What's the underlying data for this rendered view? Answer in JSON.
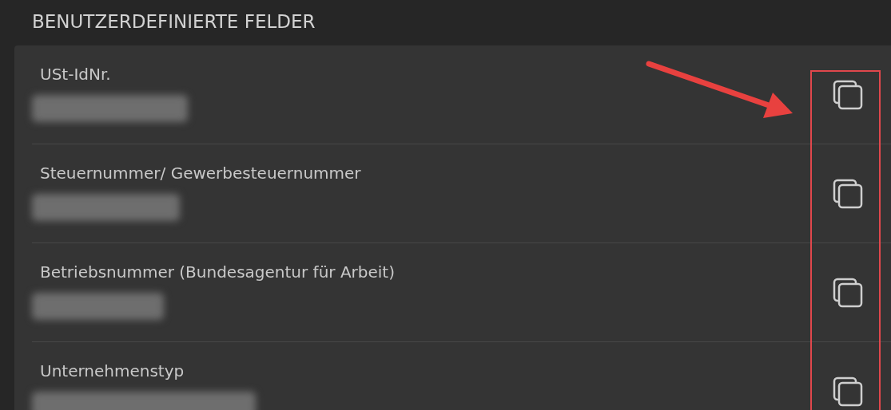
{
  "section": {
    "title": "BENUTZERDEFINIERTE FELDER"
  },
  "fields": [
    {
      "label": "USt-IdNr."
    },
    {
      "label": "Steuernummer/ Gewerbesteuernummer"
    },
    {
      "label": "Betriebsnummer (Bundesagentur für Arbeit)"
    },
    {
      "label": "Unternehmenstyp"
    }
  ]
}
